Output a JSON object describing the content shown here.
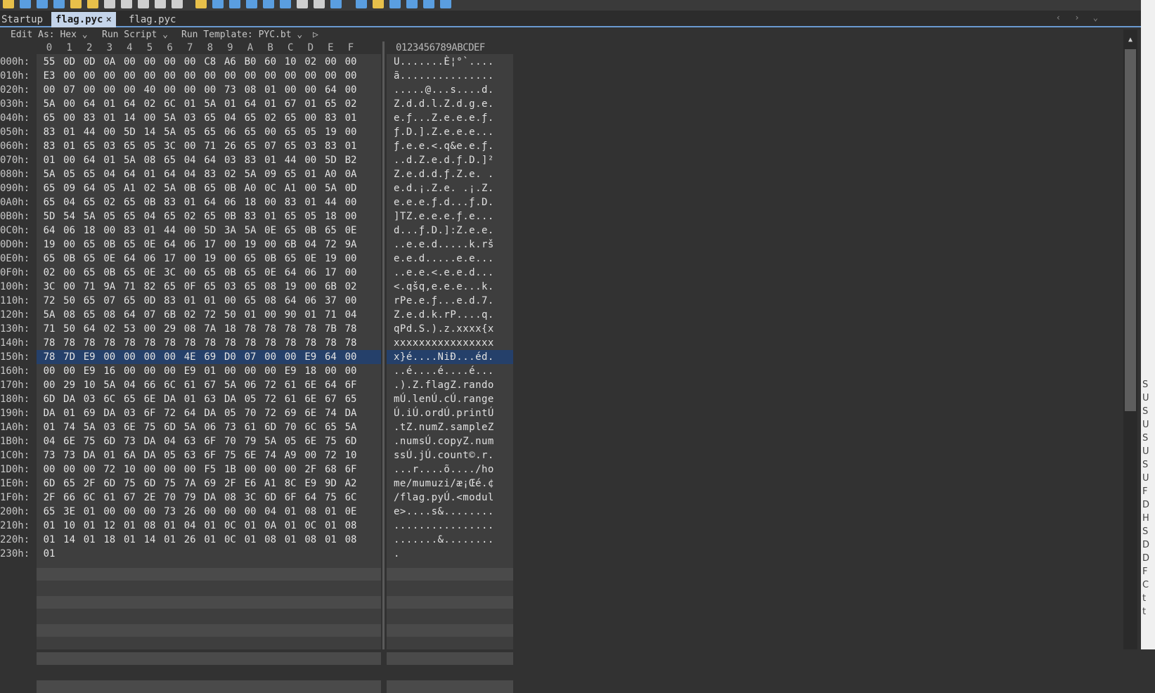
{
  "tabs": [
    {
      "label": "Startup",
      "active": false
    },
    {
      "label": "flag.pyc",
      "active": true,
      "close": "×"
    },
    {
      "label": "flag.pyc",
      "active": false
    }
  ],
  "nav_arrows": "‹ › ⌄",
  "options": {
    "edit_as": "Edit As: Hex ⌄",
    "run_script": "Run Script ⌄",
    "run_template": "Run Template: PYC.bt ⌄",
    "play": "▷"
  },
  "hex_header": [
    "0",
    "1",
    "2",
    "3",
    "4",
    "5",
    "6",
    "7",
    "8",
    "9",
    "A",
    "B",
    "C",
    "D",
    "E",
    "F"
  ],
  "text_header": "0123456789ABCDEF",
  "rows": [
    {
      "addr": "000h:",
      "bytes": [
        "55",
        "0D",
        "0D",
        "0A",
        "00",
        "00",
        "00",
        "00",
        "C8",
        "A6",
        "B0",
        "60",
        "10",
        "02",
        "00",
        "00"
      ],
      "text": "U.......È¦°`...."
    },
    {
      "addr": "010h:",
      "bytes": [
        "E3",
        "00",
        "00",
        "00",
        "00",
        "00",
        "00",
        "00",
        "00",
        "00",
        "00",
        "00",
        "00",
        "00",
        "00",
        "00"
      ],
      "text": "ã..............."
    },
    {
      "addr": "020h:",
      "bytes": [
        "00",
        "07",
        "00",
        "00",
        "00",
        "40",
        "00",
        "00",
        "00",
        "73",
        "08",
        "01",
        "00",
        "00",
        "64",
        "00"
      ],
      "text": ".....@...s....d."
    },
    {
      "addr": "030h:",
      "bytes": [
        "5A",
        "00",
        "64",
        "01",
        "64",
        "02",
        "6C",
        "01",
        "5A",
        "01",
        "64",
        "01",
        "67",
        "01",
        "65",
        "02"
      ],
      "text": "Z.d.d.l.Z.d.g.e."
    },
    {
      "addr": "040h:",
      "bytes": [
        "65",
        "00",
        "83",
        "01",
        "14",
        "00",
        "5A",
        "03",
        "65",
        "04",
        "65",
        "02",
        "65",
        "00",
        "83",
        "01"
      ],
      "text": "e.ƒ...Z.e.e.e.ƒ."
    },
    {
      "addr": "050h:",
      "bytes": [
        "83",
        "01",
        "44",
        "00",
        "5D",
        "14",
        "5A",
        "05",
        "65",
        "06",
        "65",
        "00",
        "65",
        "05",
        "19",
        "00"
      ],
      "text": "ƒ.D.].Z.e.e.e..."
    },
    {
      "addr": "060h:",
      "bytes": [
        "83",
        "01",
        "65",
        "03",
        "65",
        "05",
        "3C",
        "00",
        "71",
        "26",
        "65",
        "07",
        "65",
        "03",
        "83",
        "01"
      ],
      "text": "ƒ.e.e.<.q&e.e.ƒ."
    },
    {
      "addr": "070h:",
      "bytes": [
        "01",
        "00",
        "64",
        "01",
        "5A",
        "08",
        "65",
        "04",
        "64",
        "03",
        "83",
        "01",
        "44",
        "00",
        "5D",
        "B2"
      ],
      "text": "..d.Z.e.d.ƒ.D.]²"
    },
    {
      "addr": "080h:",
      "bytes": [
        "5A",
        "05",
        "65",
        "04",
        "64",
        "01",
        "64",
        "04",
        "83",
        "02",
        "5A",
        "09",
        "65",
        "01",
        "A0",
        "0A"
      ],
      "text": "Z.e.d.d.ƒ.Z.e. ."
    },
    {
      "addr": "090h:",
      "bytes": [
        "65",
        "09",
        "64",
        "05",
        "A1",
        "02",
        "5A",
        "0B",
        "65",
        "0B",
        "A0",
        "0C",
        "A1",
        "00",
        "5A",
        "0D"
      ],
      "text": "e.d.¡.Z.e. .¡.Z."
    },
    {
      "addr": "0A0h:",
      "bytes": [
        "65",
        "04",
        "65",
        "02",
        "65",
        "0B",
        "83",
        "01",
        "64",
        "06",
        "18",
        "00",
        "83",
        "01",
        "44",
        "00"
      ],
      "text": "e.e.e.ƒ.d...ƒ.D."
    },
    {
      "addr": "0B0h:",
      "bytes": [
        "5D",
        "54",
        "5A",
        "05",
        "65",
        "04",
        "65",
        "02",
        "65",
        "0B",
        "83",
        "01",
        "65",
        "05",
        "18",
        "00"
      ],
      "text": "]TZ.e.e.e.ƒ.e..."
    },
    {
      "addr": "0C0h:",
      "bytes": [
        "64",
        "06",
        "18",
        "00",
        "83",
        "01",
        "44",
        "00",
        "5D",
        "3A",
        "5A",
        "0E",
        "65",
        "0B",
        "65",
        "0E"
      ],
      "text": "d...ƒ.D.]:Z.e.e."
    },
    {
      "addr": "0D0h:",
      "bytes": [
        "19",
        "00",
        "65",
        "0B",
        "65",
        "0E",
        "64",
        "06",
        "17",
        "00",
        "19",
        "00",
        "6B",
        "04",
        "72",
        "9A"
      ],
      "text": "..e.e.d.....k.rš"
    },
    {
      "addr": "0E0h:",
      "bytes": [
        "65",
        "0B",
        "65",
        "0E",
        "64",
        "06",
        "17",
        "00",
        "19",
        "00",
        "65",
        "0B",
        "65",
        "0E",
        "19",
        "00"
      ],
      "text": "e.e.d.....e.e..."
    },
    {
      "addr": "0F0h:",
      "bytes": [
        "02",
        "00",
        "65",
        "0B",
        "65",
        "0E",
        "3C",
        "00",
        "65",
        "0B",
        "65",
        "0E",
        "64",
        "06",
        "17",
        "00"
      ],
      "text": "..e.e.<.e.e.d..."
    },
    {
      "addr": "100h:",
      "bytes": [
        "3C",
        "00",
        "71",
        "9A",
        "71",
        "82",
        "65",
        "0F",
        "65",
        "03",
        "65",
        "08",
        "19",
        "00",
        "6B",
        "02"
      ],
      "text": "<.qšq‚e.e.e...k."
    },
    {
      "addr": "110h:",
      "bytes": [
        "72",
        "50",
        "65",
        "07",
        "65",
        "0D",
        "83",
        "01",
        "01",
        "00",
        "65",
        "08",
        "64",
        "06",
        "37",
        "00"
      ],
      "text": "rPe.e.ƒ...e.d.7."
    },
    {
      "addr": "120h:",
      "bytes": [
        "5A",
        "08",
        "65",
        "08",
        "64",
        "07",
        "6B",
        "02",
        "72",
        "50",
        "01",
        "00",
        "90",
        "01",
        "71",
        "04"
      ],
      "text": "Z.e.d.k.rP....q."
    },
    {
      "addr": "130h:",
      "bytes": [
        "71",
        "50",
        "64",
        "02",
        "53",
        "00",
        "29",
        "08",
        "7A",
        "18",
        "78",
        "78",
        "78",
        "78",
        "7B",
        "78"
      ],
      "text": "qPd.S.).z.xxxx{x"
    },
    {
      "addr": "140h:",
      "bytes": [
        "78",
        "78",
        "78",
        "78",
        "78",
        "78",
        "78",
        "78",
        "78",
        "78",
        "78",
        "78",
        "78",
        "78",
        "78",
        "78"
      ],
      "text": "xxxxxxxxxxxxxxxx"
    },
    {
      "addr": "150h:",
      "bytes": [
        "78",
        "7D",
        "E9",
        "00",
        "00",
        "00",
        "00",
        "4E",
        "69",
        "D0",
        "07",
        "00",
        "00",
        "E9",
        "64",
        "00"
      ],
      "text": "x}é....NiÐ...éd.",
      "highlight": true
    },
    {
      "addr": "160h:",
      "bytes": [
        "00",
        "00",
        "E9",
        "16",
        "00",
        "00",
        "00",
        "E9",
        "01",
        "00",
        "00",
        "00",
        "E9",
        "18",
        "00",
        "00"
      ],
      "text": "..é....é....é..."
    },
    {
      "addr": "170h:",
      "bytes": [
        "00",
        "29",
        "10",
        "5A",
        "04",
        "66",
        "6C",
        "61",
        "67",
        "5A",
        "06",
        "72",
        "61",
        "6E",
        "64",
        "6F"
      ],
      "text": ".).Z.flagZ.rando"
    },
    {
      "addr": "180h:",
      "bytes": [
        "6D",
        "DA",
        "03",
        "6C",
        "65",
        "6E",
        "DA",
        "01",
        "63",
        "DA",
        "05",
        "72",
        "61",
        "6E",
        "67",
        "65"
      ],
      "text": "mÚ.lenÚ.cÚ.range"
    },
    {
      "addr": "190h:",
      "bytes": [
        "DA",
        "01",
        "69",
        "DA",
        "03",
        "6F",
        "72",
        "64",
        "DA",
        "05",
        "70",
        "72",
        "69",
        "6E",
        "74",
        "DA"
      ],
      "text": "Ú.iÚ.ordÚ.printÚ"
    },
    {
      "addr": "1A0h:",
      "bytes": [
        "01",
        "74",
        "5A",
        "03",
        "6E",
        "75",
        "6D",
        "5A",
        "06",
        "73",
        "61",
        "6D",
        "70",
        "6C",
        "65",
        "5A"
      ],
      "text": ".tZ.numZ.sampleZ"
    },
    {
      "addr": "1B0h:",
      "bytes": [
        "04",
        "6E",
        "75",
        "6D",
        "73",
        "DA",
        "04",
        "63",
        "6F",
        "70",
        "79",
        "5A",
        "05",
        "6E",
        "75",
        "6D"
      ],
      "text": ".numsÚ.copyZ.num"
    },
    {
      "addr": "1C0h:",
      "bytes": [
        "73",
        "73",
        "DA",
        "01",
        "6A",
        "DA",
        "05",
        "63",
        "6F",
        "75",
        "6E",
        "74",
        "A9",
        "00",
        "72",
        "10"
      ],
      "text": "ssÚ.jÚ.count©.r."
    },
    {
      "addr": "1D0h:",
      "bytes": [
        "00",
        "00",
        "00",
        "72",
        "10",
        "00",
        "00",
        "00",
        "F5",
        "1B",
        "00",
        "00",
        "00",
        "2F",
        "68",
        "6F"
      ],
      "text": "...r....õ..../ho"
    },
    {
      "addr": "1E0h:",
      "bytes": [
        "6D",
        "65",
        "2F",
        "6D",
        "75",
        "6D",
        "75",
        "7A",
        "69",
        "2F",
        "E6",
        "A1",
        "8C",
        "E9",
        "9D",
        "A2"
      ],
      "text": "me/mumuzi/æ¡Œé.¢"
    },
    {
      "addr": "1F0h:",
      "bytes": [
        "2F",
        "66",
        "6C",
        "61",
        "67",
        "2E",
        "70",
        "79",
        "DA",
        "08",
        "3C",
        "6D",
        "6F",
        "64",
        "75",
        "6C"
      ],
      "text": "/flag.pyÚ.<modul"
    },
    {
      "addr": "200h:",
      "bytes": [
        "65",
        "3E",
        "01",
        "00",
        "00",
        "00",
        "73",
        "26",
        "00",
        "00",
        "00",
        "04",
        "01",
        "08",
        "01",
        "0E"
      ],
      "text": "e>....s&........"
    },
    {
      "addr": "210h:",
      "bytes": [
        "01",
        "10",
        "01",
        "12",
        "01",
        "08",
        "01",
        "04",
        "01",
        "0C",
        "01",
        "0A",
        "01",
        "0C",
        "01",
        "08"
      ],
      "text": "................"
    },
    {
      "addr": "220h:",
      "bytes": [
        "01",
        "14",
        "01",
        "18",
        "01",
        "14",
        "01",
        "26",
        "01",
        "0C",
        "01",
        "08",
        "01",
        "08",
        "01",
        "08"
      ],
      "text": ".......&........"
    },
    {
      "addr": "230h:",
      "bytes": [
        "01"
      ],
      "text": "."
    }
  ],
  "right_strip_letters": [
    "S",
    "U",
    "S",
    "U",
    "S",
    "U",
    "S",
    "U",
    "F",
    "D",
    "H",
    "S",
    "D",
    "D",
    "F",
    "C",
    "t",
    "t"
  ],
  "colors": {
    "background": "#323232",
    "panel": "#3e3e3e",
    "highlight": "#25406a",
    "active_tab": "#c4d4ea",
    "accent": "#6a9ad0"
  }
}
